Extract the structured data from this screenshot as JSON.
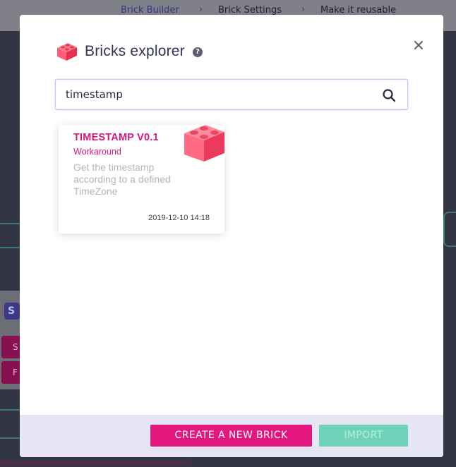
{
  "background": {
    "breadcrumb": [
      "Brick Builder",
      "Brick Settings",
      "Make it reusable"
    ],
    "chip_label": "S",
    "buttons": [
      "S",
      "F"
    ]
  },
  "modal": {
    "title": "Bricks explorer",
    "help_icon": "question-circle-icon",
    "close_icon": "close-icon",
    "brand_color": "#e4177f"
  },
  "search": {
    "value": "timestamp",
    "placeholder": "",
    "icon": "search-icon"
  },
  "results": [
    {
      "name": "TIMESTAMP V0.1",
      "category": "Workaround",
      "description": "Get the timestamp according to a defined TimeZone",
      "date": "2019-12-10 14:18",
      "icon": "brick-icon"
    }
  ],
  "footer": {
    "create_label": "CREATE A NEW BRICK",
    "import_label": "IMPORT",
    "import_color": "#6ed3b9"
  }
}
